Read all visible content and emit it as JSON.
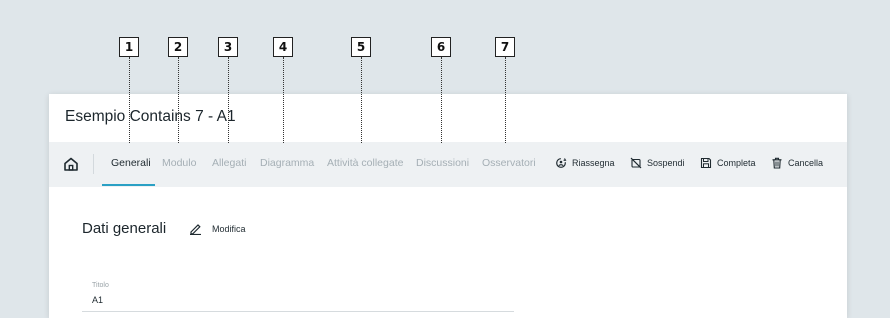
{
  "callouts": [
    "1",
    "2",
    "3",
    "4",
    "5",
    "6",
    "7"
  ],
  "page": {
    "title": "Esempio Contains 7 - A1"
  },
  "tabs": [
    {
      "label": "Generali",
      "active": true
    },
    {
      "label": "Modulo",
      "active": false
    },
    {
      "label": "Allegati",
      "active": false
    },
    {
      "label": "Diagramma",
      "active": false
    },
    {
      "label": "Attività collegate",
      "active": false
    },
    {
      "label": "Discussioni",
      "active": false
    },
    {
      "label": "Osservatori",
      "active": false
    }
  ],
  "actions": [
    {
      "label": "Riassegna",
      "icon": "reassign-icon"
    },
    {
      "label": "Sospendi",
      "icon": "suspend-icon"
    },
    {
      "label": "Completa",
      "icon": "save-icon"
    },
    {
      "label": "Cancella",
      "icon": "trash-icon"
    }
  ],
  "section": {
    "title": "Dati generali",
    "edit_label": "Modifica"
  },
  "fields": {
    "title_label": "Titolo",
    "title_value": "A1"
  },
  "colors": {
    "accent": "#2aa0c4",
    "tabbar": "#eef1f3",
    "background": "#dfe6ea"
  }
}
